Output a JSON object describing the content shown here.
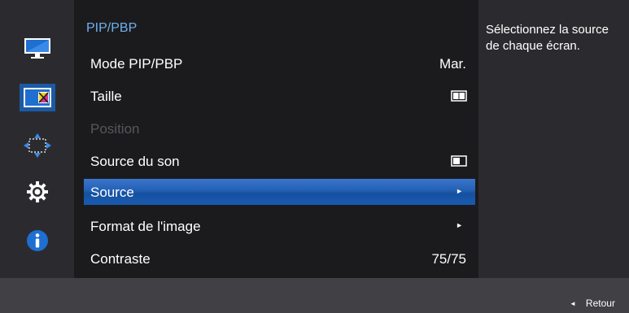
{
  "menu": {
    "title": "PIP/PBP",
    "items": [
      {
        "label": "Mode PIP/PBP",
        "value": "Mar."
      },
      {
        "label": "Taille",
        "icon": "pbp-size-icon"
      },
      {
        "label": "Position"
      },
      {
        "label": "Source du son",
        "icon": "sound-source-icon"
      },
      {
        "label": "Source",
        "arrow": "►"
      },
      {
        "label": "Format de l'image",
        "arrow": "►"
      },
      {
        "label": "Contraste",
        "value": "75/75"
      }
    ]
  },
  "help": {
    "text": "Sélectionnez la source de chaque écran."
  },
  "bottom": {
    "back_arrow": "◄",
    "back_label": "Retour"
  },
  "sidebar": {
    "icons": [
      "monitor-icon",
      "pip-pbp-icon",
      "screen-position-icon",
      "gear-icon",
      "info-icon"
    ],
    "selected": "pip-pbp-icon"
  },
  "colors": {
    "accent": "#1c5aa6",
    "title": "#6fb0ee",
    "disabled": "#57575b"
  }
}
